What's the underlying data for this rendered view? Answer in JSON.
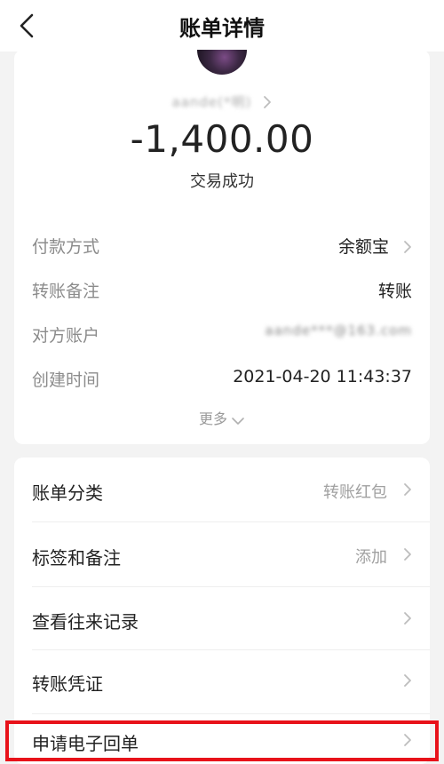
{
  "nav": {
    "title": "账单详情"
  },
  "payee": {
    "name_masked": "aande(*明)"
  },
  "amount": "-1,400.00",
  "status": "交易成功",
  "details": [
    {
      "label": "付款方式",
      "value": "余额宝",
      "chevron": true
    },
    {
      "label": "转账备注",
      "value": "转账",
      "chevron": false
    },
    {
      "label": "对方账户",
      "value": "aande***@163.com",
      "masked": true
    },
    {
      "label": "创建时间",
      "value": "2021-04-20 11:43:37"
    }
  ],
  "more_label": "更多",
  "list": [
    {
      "label": "账单分类",
      "value": "转账红包"
    },
    {
      "label": "标签和备注",
      "value": "添加"
    },
    {
      "label": "查看往来记录",
      "value": ""
    },
    {
      "label": "转账凭证",
      "value": ""
    },
    {
      "label": "申请电子回单",
      "value": ""
    }
  ],
  "highlight_color": "#e8121a"
}
